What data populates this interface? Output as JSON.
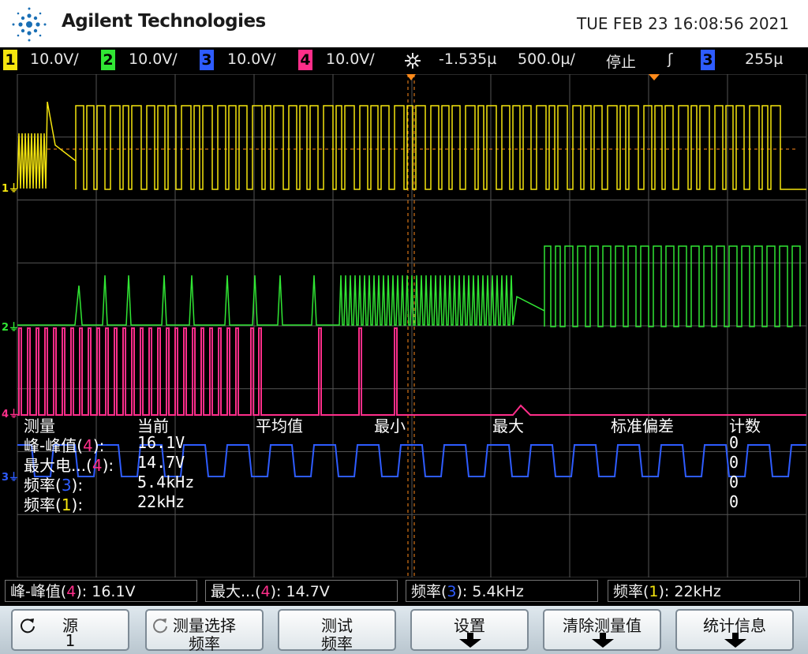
{
  "header": {
    "brand": "Agilent Technologies",
    "datetime": "TUE FEB 23 16:08:56 2021"
  },
  "scales": {
    "ch1": {
      "num": "1",
      "value": "10.0V/",
      "color": "#f5e50e"
    },
    "ch2": {
      "num": "2",
      "value": "10.0V/",
      "color": "#31e634"
    },
    "ch3": {
      "num": "3",
      "value": "10.0V/",
      "color": "#2e5cff"
    },
    "ch4": {
      "num": "4",
      "value": "10.0V/",
      "color": "#ff2e8a"
    },
    "delay": "-1.535µ",
    "timebase": "500.0µ/",
    "run_state": "停止",
    "trigger_edge": "ʃ",
    "trigger_source": "3",
    "trigger_level": "255µ"
  },
  "measurements": {
    "headers": {
      "name": "测量",
      "current": "当前",
      "mean": "平均值",
      "min": "最小",
      "max": "最大",
      "std": "标准偏差",
      "count": "计数"
    },
    "rows": [
      {
        "pre": "峰-峰值(",
        "ch": "4",
        "post": "):",
        "current": "16.1V",
        "count": "0",
        "color": "#ff2e8a"
      },
      {
        "pre": "最大电...(",
        "ch": "4",
        "post": "):",
        "current": "14.7V",
        "count": "0",
        "color": "#ff2e8a"
      },
      {
        "pre": "频率(",
        "ch": "3",
        "post": "):",
        "current": "5.4kHz",
        "count": "0",
        "color": "#2e5cff"
      },
      {
        "pre": "频率(",
        "ch": "1",
        "post": "):",
        "current": "22kHz",
        "count": "0",
        "color": "#f5e50e"
      }
    ]
  },
  "status_boxes": [
    {
      "pre": "峰-峰值(",
      "ch": "4",
      "post": "): 16.1V",
      "color": "#ff2e8a"
    },
    {
      "pre": "最大...(",
      "ch": "4",
      "post": "): 14.7V",
      "color": "#ff2e8a"
    },
    {
      "pre": "频率(",
      "ch": "3",
      "post": "): 5.4kHz",
      "color": "#2e5cff"
    },
    {
      "pre": "频率(",
      "ch": "1",
      "post": "): 22kHz",
      "color": "#f5e50e"
    }
  ],
  "softkeys": [
    {
      "l1": "源",
      "l2": "1",
      "icon": "rotate-knob-icon"
    },
    {
      "l1": "测量选择",
      "l2": "频率",
      "icon": "rotate-knob-icon"
    },
    {
      "l1": "测试",
      "l2": "频率",
      "icon": ""
    },
    {
      "l1": "设置",
      "l2": "",
      "icon": "down-arrow-icon"
    },
    {
      "l1": "清除测量值",
      "l2": "",
      "icon": "down-arrow-icon"
    },
    {
      "l1": "统计信息",
      "l2": "",
      "icon": "down-arrow-icon"
    }
  ],
  "ground_markers": [
    {
      "label": "1",
      "color": "#f5e50e"
    },
    {
      "label": "2",
      "color": "#31e634"
    },
    {
      "label": "3",
      "color": "#2e5cff"
    },
    {
      "label": "4",
      "color": "#ff2e8a"
    }
  ]
}
